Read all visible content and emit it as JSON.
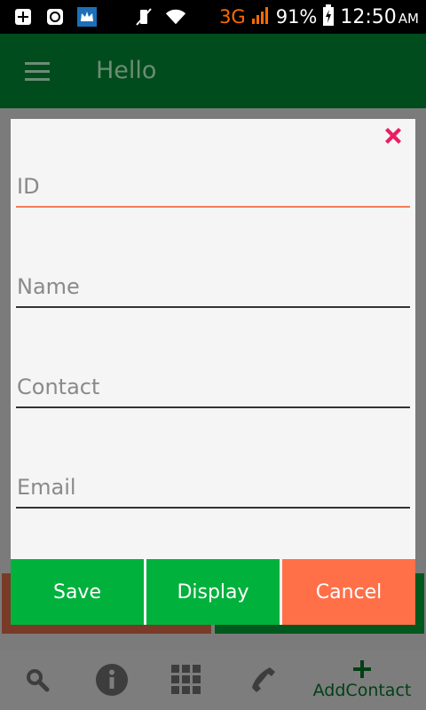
{
  "status_bar": {
    "icons": [
      "add-box-icon",
      "sync-icon",
      "crown-app-icon",
      "vibrate-off-icon",
      "wifi-icon"
    ],
    "network": "3G",
    "battery": "91%",
    "time": "12:50",
    "ampm": "AM"
  },
  "app_bar": {
    "title": "Hello",
    "menu_icon": "hamburger-menu-icon"
  },
  "dialog": {
    "close_icon": "close-icon",
    "accent_color": "#e91e63",
    "fields": [
      {
        "placeholder": "ID",
        "value": ""
      },
      {
        "placeholder": "Name",
        "value": ""
      },
      {
        "placeholder": "Contact",
        "value": ""
      },
      {
        "placeholder": "Email",
        "value": ""
      }
    ],
    "buttons": {
      "save": "Save",
      "display": "Display",
      "cancel": "Cancel"
    },
    "colors": {
      "primary_button": "#00b13c",
      "cancel_button": "#ff7049",
      "active_underline": "#f47c5b"
    }
  },
  "bottom_nav": {
    "items": [
      {
        "icon": "search-icon"
      },
      {
        "icon": "info-icon"
      },
      {
        "icon": "grid-icon"
      },
      {
        "icon": "phone-icon"
      },
      {
        "icon": "add-icon",
        "label": "AddContact"
      }
    ]
  }
}
